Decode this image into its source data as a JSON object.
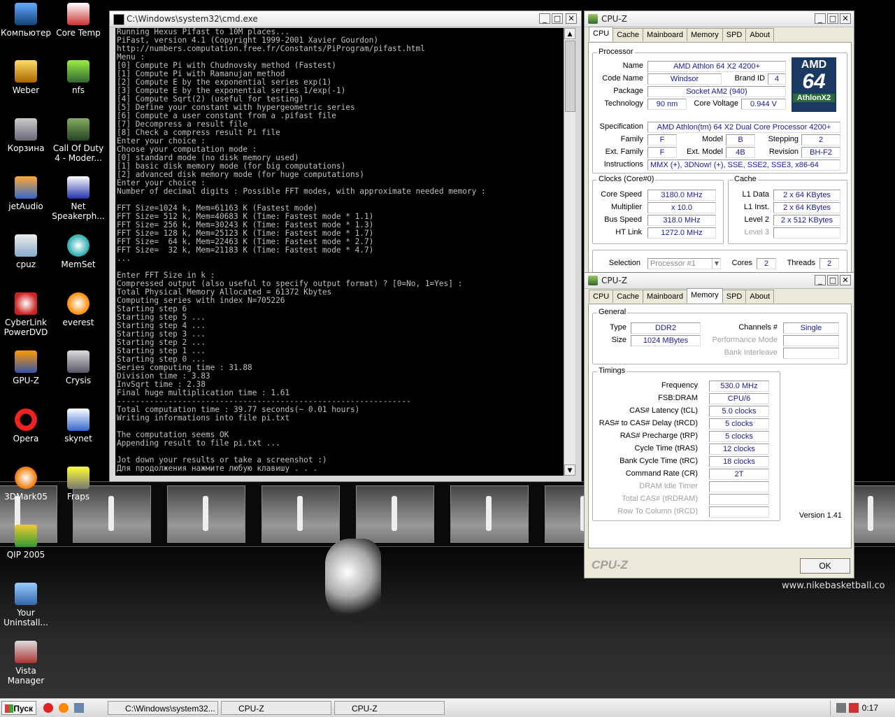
{
  "desktop": {
    "icons": [
      {
        "label": "Компьютер",
        "x": 0
      },
      {
        "label": "Core Temp"
      },
      {
        "label": "Weber"
      },
      {
        "label": "nfs"
      },
      {
        "label": "Корзина"
      },
      {
        "label": "Call Of Duty 4 - Moder..."
      },
      {
        "label": "jetAudio"
      },
      {
        "label": "Net Speakerph..."
      },
      {
        "label": "cpuz"
      },
      {
        "label": "MemSet"
      },
      {
        "label": "CyberLink PowerDVD"
      },
      {
        "label": "everest"
      },
      {
        "label": "GPU-Z"
      },
      {
        "label": "Crysis"
      },
      {
        "label": "Opera"
      },
      {
        "label": "skynet"
      },
      {
        "label": "3DMark05"
      },
      {
        "label": "Fraps"
      },
      {
        "label": "QIP 2005"
      },
      {
        "label": "Your Uninstall..."
      },
      {
        "label": "Vista Manager"
      }
    ],
    "wallpaper_text": "www.nikebasketball.co"
  },
  "cmd": {
    "title": "C:\\Windows\\system32\\cmd.exe",
    "output": "Running Hexus Pifast to 10M places...\nPiFast, version 4.1 (Copyright 1999-2001 Xavier Gourdon)\nhttp://numbers.computation.free.fr/Constants/PiProgram/pifast.html\nMenu :\n[0] Compute Pi with Chudnovsky method (Fastest)\n[1] Compute Pi with Ramanujan method\n[2] Compute E by the exponential series exp(1)\n[3] Compute E by the exponential series 1/exp(-1)\n[4] Compute Sqrt(2) (useful for testing)\n[5] Define your constant with hypergeometric series\n[6] Compute a user constant from a .pifast file\n[7] Decompress a result file\n[8] Check a compress result Pi file\nEnter your choice :\nChoose your computation mode :\n[0] standard mode (no disk memory used)\n[1] basic disk memory mode (for big computations)\n[2] advanced disk memory mode (for huge computations)\nEnter your choice :\nNumber of decimal digits : Possible FFT modes, with approximate needed memory :\n\nFFT Size=1024 k, Mem=61163 K (Fastest mode)\nFFT Size= 512 k, Mem=40683 K (Time: Fastest mode * 1.1)\nFFT Size= 256 k, Mem=30243 K (Time: Fastest mode * 1.3)\nFFT Size= 128 k, Mem=25123 K (Time: Fastest mode * 1.7)\nFFT Size=  64 k, Mem=22463 K (Time: Fastest mode * 2.7)\nFFT Size=  32 k, Mem=21183 K (Time: Fastest mode * 4.7)\n...\n\nEnter FFT Size in k :\nCompressed output (also useful to specify output format) ? [0=No, 1=Yes] :\nTotal Physical Memory Allocated = 61372 Kbytes\nComputing series with index N=705226\nStarting step 6\nStarting step 5 ...\nStarting step 4 ...\nStarting step 3 ...\nStarting step 2 ...\nStarting step 1 ...\nStarting step 0 ...\nSeries computing time : 31.88\nDivision time : 3.83\nInvSqrt time : 2.38\nFinal huge multiplication time : 1.61\n---------------------------------------------------------------\nTotal computation time : 39.77 seconds(~ 0.01 hours)\nWriting informations into file pi.txt\n\nThe computation seems OK\nAppending result to file pi.txt ...\n\nJot down your results or take a screenshot :)\nДля продолжения нажмите любую клавишу . . ."
  },
  "cpuz1": {
    "title": "CPU-Z",
    "tabs": [
      "CPU",
      "Cache",
      "Mainboard",
      "Memory",
      "SPD",
      "About"
    ],
    "processor": {
      "group": "Processor",
      "name_label": "Name",
      "name": "AMD Athlon 64 X2 4200+",
      "codename_label": "Code Name",
      "codename": "Windsor",
      "brandid_label": "Brand ID",
      "brandid": "4",
      "package_label": "Package",
      "package": "Socket AM2 (940)",
      "technology_label": "Technology",
      "technology": "90 nm",
      "voltage_label": "Core Voltage",
      "voltage": "0.944 V",
      "spec_label": "Specification",
      "spec": "AMD Athlon(tm) 64 X2 Dual Core Processor 4200+",
      "family_label": "Family",
      "family": "F",
      "model_label": "Model",
      "model": "B",
      "stepping_label": "Stepping",
      "stepping": "2",
      "extfamily_label": "Ext. Family",
      "extfamily": "F",
      "extmodel_label": "Ext. Model",
      "extmodel": "4B",
      "revision_label": "Revision",
      "revision": "BH-F2",
      "instructions_label": "Instructions",
      "instructions": "MMX (+), 3DNow! (+), SSE, SSE2, SSE3, x86-64",
      "logo_top": "AMD",
      "logo_mid": "64",
      "logo_bottom": "AthlonX2"
    },
    "clocks": {
      "group": "Clocks (Core#0)",
      "corespeed_label": "Core Speed",
      "corespeed": "3180.0 MHz",
      "multiplier_label": "Multiplier",
      "multiplier": "x 10.0",
      "busspeed_label": "Bus Speed",
      "busspeed": "318.0 MHz",
      "htlink_label": "HT Link",
      "htlink": "1272.0 MHz"
    },
    "cache": {
      "group": "Cache",
      "l1data_label": "L1 Data",
      "l1data": "2 x 64 KBytes",
      "l1inst_label": "L1 Inst.",
      "l1inst": "2 x 64 KBytes",
      "level2_label": "Level 2",
      "level2": "2 x 512 KBytes",
      "level3_label": "Level 3",
      "level3": ""
    },
    "selection_label": "Selection",
    "selection": "Processor #1",
    "cores_label": "Cores",
    "cores": "2",
    "threads_label": "Threads",
    "threads": "2"
  },
  "cpuz2": {
    "title": "CPU-Z",
    "tabs": [
      "CPU",
      "Cache",
      "Mainboard",
      "Memory",
      "SPD",
      "About"
    ],
    "general": {
      "group": "General",
      "type_label": "Type",
      "type": "DDR2",
      "size_label": "Size",
      "size": "1024 MBytes",
      "channels_label": "Channels #",
      "channels": "Single",
      "perfmode_label": "Performance Mode",
      "perfmode": "",
      "interleave_label": "Bank Interleave",
      "interleave": ""
    },
    "timings": {
      "group": "Timings",
      "rows": [
        {
          "label": "Frequency",
          "value": "530.0 MHz",
          "dim": false
        },
        {
          "label": "FSB:DRAM",
          "value": "CPU/6",
          "dim": false
        },
        {
          "label": "CAS# Latency (tCL)",
          "value": "5.0 clocks",
          "dim": false
        },
        {
          "label": "RAS# to CAS# Delay (tRCD)",
          "value": "5 clocks",
          "dim": false
        },
        {
          "label": "RAS# Precharge (tRP)",
          "value": "5 clocks",
          "dim": false
        },
        {
          "label": "Cycle Time (tRAS)",
          "value": "12 clocks",
          "dim": false
        },
        {
          "label": "Bank Cycle Time (tRC)",
          "value": "18 clocks",
          "dim": false
        },
        {
          "label": "Command Rate (CR)",
          "value": "2T",
          "dim": false
        },
        {
          "label": "DRAM Idle Timer",
          "value": "",
          "dim": true
        },
        {
          "label": "Total CAS# (tRDRAM)",
          "value": "",
          "dim": true
        },
        {
          "label": "Row To Column (tRCD)",
          "value": "",
          "dim": true
        }
      ]
    },
    "version": "Version 1.41",
    "brand": "CPU-Z",
    "ok_label": "OK"
  },
  "taskbar": {
    "start_label": "Пуск",
    "tasks": [
      "C:\\Windows\\system32...",
      "CPU-Z",
      "CPU-Z"
    ],
    "clock": "0:17"
  }
}
